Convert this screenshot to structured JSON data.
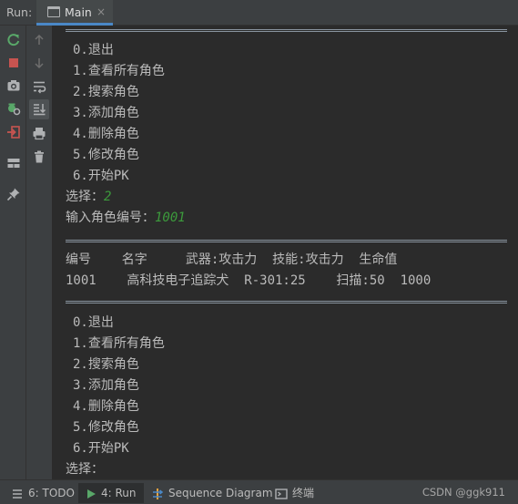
{
  "run_panel": {
    "label": "Run:",
    "tab_label": "Main",
    "tab_close": "×"
  },
  "toolbar": {
    "left_icons": [
      "rerun-icon",
      "stop-icon",
      "camera-icon",
      "debug-settings-icon",
      "exit-icon",
      "layout-icon",
      "pin-icon"
    ],
    "second_icons": [
      "up-arrow-icon",
      "down-arrow-icon",
      "soft-wrap-icon",
      "scroll-to-end-icon",
      "print-icon",
      "trash-icon"
    ]
  },
  "console": {
    "separator": "==================================================",
    "menu1": [
      "0.退出",
      "1.查看所有角色",
      "2.搜索角色",
      "3.添加角色",
      "4.删除角色",
      "5.修改角色",
      "6.开始PK"
    ],
    "prompt_select": "选择：",
    "select_value": "2",
    "prompt_id": "输入角色编号：",
    "id_value": "1001",
    "table_header": "编号    名字     武器:攻击力  技能:攻击力  生命值",
    "table_row": "1001    高科技电子追踪犬  R-301:25    扫描:50  1000",
    "menu2": [
      "0.退出",
      "1.查看所有角色",
      "2.搜索角色",
      "3.添加角色",
      "4.删除角色",
      "5.修改角色",
      "6.开始PK"
    ],
    "prompt_select2": "选择："
  },
  "statusbar": {
    "todo": "6: TODO",
    "run": "4: Run",
    "sequence": "Sequence Diagram",
    "terminal": "终端",
    "watermark": "CSDN @ggk911"
  },
  "colors": {
    "background": "#2b2b2b",
    "panel": "#3c3f41",
    "text": "#bbbbbb",
    "input_green": "#3c9b3c",
    "accent": "#4a88c7"
  }
}
